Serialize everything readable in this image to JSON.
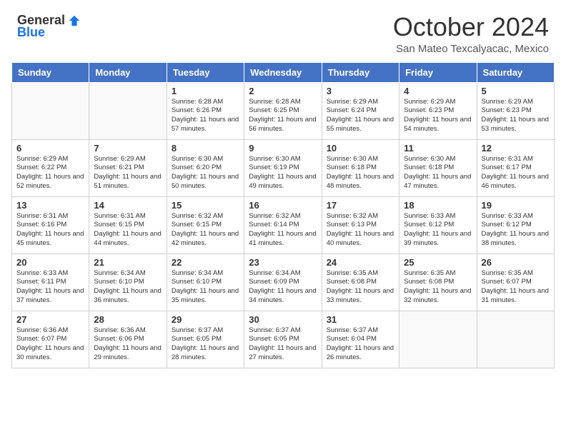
{
  "header": {
    "logo_general": "General",
    "logo_blue": "Blue",
    "month_year": "October 2024",
    "location": "San Mateo Texcalyacac, Mexico"
  },
  "days_of_week": [
    "Sunday",
    "Monday",
    "Tuesday",
    "Wednesday",
    "Thursday",
    "Friday",
    "Saturday"
  ],
  "weeks": [
    [
      {
        "day": "",
        "info": ""
      },
      {
        "day": "",
        "info": ""
      },
      {
        "day": "1",
        "info": "Sunrise: 6:28 AM\nSunset: 6:26 PM\nDaylight: 11 hours and 57 minutes."
      },
      {
        "day": "2",
        "info": "Sunrise: 6:28 AM\nSunset: 6:25 PM\nDaylight: 11 hours and 56 minutes."
      },
      {
        "day": "3",
        "info": "Sunrise: 6:29 AM\nSunset: 6:24 PM\nDaylight: 11 hours and 55 minutes."
      },
      {
        "day": "4",
        "info": "Sunrise: 6:29 AM\nSunset: 6:23 PM\nDaylight: 11 hours and 54 minutes."
      },
      {
        "day": "5",
        "info": "Sunrise: 6:29 AM\nSunset: 6:23 PM\nDaylight: 11 hours and 53 minutes."
      }
    ],
    [
      {
        "day": "6",
        "info": "Sunrise: 6:29 AM\nSunset: 6:22 PM\nDaylight: 11 hours and 52 minutes."
      },
      {
        "day": "7",
        "info": "Sunrise: 6:29 AM\nSunset: 6:21 PM\nDaylight: 11 hours and 51 minutes."
      },
      {
        "day": "8",
        "info": "Sunrise: 6:30 AM\nSunset: 6:20 PM\nDaylight: 11 hours and 50 minutes."
      },
      {
        "day": "9",
        "info": "Sunrise: 6:30 AM\nSunset: 6:19 PM\nDaylight: 11 hours and 49 minutes."
      },
      {
        "day": "10",
        "info": "Sunrise: 6:30 AM\nSunset: 6:18 PM\nDaylight: 11 hours and 48 minutes."
      },
      {
        "day": "11",
        "info": "Sunrise: 6:30 AM\nSunset: 6:18 PM\nDaylight: 11 hours and 47 minutes."
      },
      {
        "day": "12",
        "info": "Sunrise: 6:31 AM\nSunset: 6:17 PM\nDaylight: 11 hours and 46 minutes."
      }
    ],
    [
      {
        "day": "13",
        "info": "Sunrise: 6:31 AM\nSunset: 6:16 PM\nDaylight: 11 hours and 45 minutes."
      },
      {
        "day": "14",
        "info": "Sunrise: 6:31 AM\nSunset: 6:15 PM\nDaylight: 11 hours and 44 minutes."
      },
      {
        "day": "15",
        "info": "Sunrise: 6:32 AM\nSunset: 6:15 PM\nDaylight: 11 hours and 42 minutes."
      },
      {
        "day": "16",
        "info": "Sunrise: 6:32 AM\nSunset: 6:14 PM\nDaylight: 11 hours and 41 minutes."
      },
      {
        "day": "17",
        "info": "Sunrise: 6:32 AM\nSunset: 6:13 PM\nDaylight: 11 hours and 40 minutes."
      },
      {
        "day": "18",
        "info": "Sunrise: 6:33 AM\nSunset: 6:12 PM\nDaylight: 11 hours and 39 minutes."
      },
      {
        "day": "19",
        "info": "Sunrise: 6:33 AM\nSunset: 6:12 PM\nDaylight: 11 hours and 38 minutes."
      }
    ],
    [
      {
        "day": "20",
        "info": "Sunrise: 6:33 AM\nSunset: 6:11 PM\nDaylight: 11 hours and 37 minutes."
      },
      {
        "day": "21",
        "info": "Sunrise: 6:34 AM\nSunset: 6:10 PM\nDaylight: 11 hours and 36 minutes."
      },
      {
        "day": "22",
        "info": "Sunrise: 6:34 AM\nSunset: 6:10 PM\nDaylight: 11 hours and 35 minutes."
      },
      {
        "day": "23",
        "info": "Sunrise: 6:34 AM\nSunset: 6:09 PM\nDaylight: 11 hours and 34 minutes."
      },
      {
        "day": "24",
        "info": "Sunrise: 6:35 AM\nSunset: 6:08 PM\nDaylight: 11 hours and 33 minutes."
      },
      {
        "day": "25",
        "info": "Sunrise: 6:35 AM\nSunset: 6:08 PM\nDaylight: 11 hours and 32 minutes."
      },
      {
        "day": "26",
        "info": "Sunrise: 6:35 AM\nSunset: 6:07 PM\nDaylight: 11 hours and 31 minutes."
      }
    ],
    [
      {
        "day": "27",
        "info": "Sunrise: 6:36 AM\nSunset: 6:07 PM\nDaylight: 11 hours and 30 minutes."
      },
      {
        "day": "28",
        "info": "Sunrise: 6:36 AM\nSunset: 6:06 PM\nDaylight: 11 hours and 29 minutes."
      },
      {
        "day": "29",
        "info": "Sunrise: 6:37 AM\nSunset: 6:05 PM\nDaylight: 11 hours and 28 minutes."
      },
      {
        "day": "30",
        "info": "Sunrise: 6:37 AM\nSunset: 6:05 PM\nDaylight: 11 hours and 27 minutes."
      },
      {
        "day": "31",
        "info": "Sunrise: 6:37 AM\nSunset: 6:04 PM\nDaylight: 11 hours and 26 minutes."
      },
      {
        "day": "",
        "info": ""
      },
      {
        "day": "",
        "info": ""
      }
    ]
  ]
}
